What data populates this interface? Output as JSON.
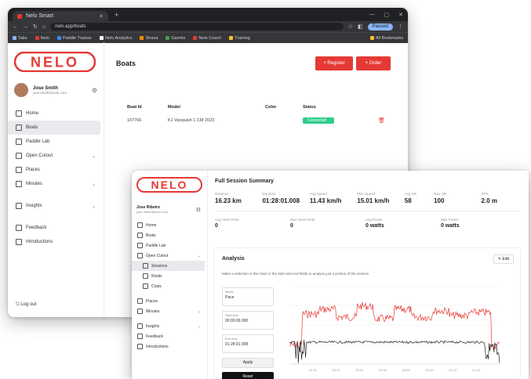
{
  "browser": {
    "tab_title": "Nelo Smart",
    "url": "nelo.app/boats",
    "profile_label": "Paused",
    "bookmarks": [
      "Tabs",
      "Nelo",
      "Paddle Tracker",
      "Nelo Analytics",
      "Strava",
      "Garmin",
      "Nelo Coach",
      "Training",
      "All Bookmarks"
    ]
  },
  "app1": {
    "logo_text": "NELO",
    "user": {
      "name": "Jose Smith",
      "email": "jose.smith@nelo.com"
    },
    "nav": [
      {
        "label": "Home",
        "icon": "home-icon"
      },
      {
        "label": "Boats",
        "icon": "boat-icon"
      },
      {
        "label": "Paddle Lab",
        "icon": "paddle-icon"
      },
      {
        "label": "Open Cutout",
        "icon": "session-icon"
      },
      {
        "label": "Places",
        "icon": "place-icon"
      },
      {
        "label": "Minutes",
        "icon": "clock-icon"
      },
      {
        "label": "Insights",
        "icon": "chart-icon"
      },
      {
        "label": "Feedback",
        "icon": "feedback-icon"
      },
      {
        "label": "Introductions",
        "icon": "users-icon"
      }
    ],
    "logout_label": "Log out",
    "page_title": "Boats",
    "buttons": {
      "register": "+ Register",
      "order": "+ Order"
    },
    "table": {
      "headers": [
        "Boat Id",
        "Model",
        "Color",
        "Status"
      ],
      "rows": [
        {
          "id": "107766",
          "model": "K1 Vanquish 1 CM 2023",
          "color": "",
          "status": "Connected"
        }
      ]
    }
  },
  "app2": {
    "logo_text": "NELO",
    "user": {
      "name": "Jose Ribeiro",
      "email": "jose.ribeiro@nelo.com"
    },
    "nav": [
      {
        "label": "Home",
        "sub": false,
        "chev": false,
        "active": false
      },
      {
        "label": "Boats",
        "sub": false,
        "chev": false,
        "active": false
      },
      {
        "label": "Paddle Lab",
        "sub": false,
        "chev": false,
        "active": false
      },
      {
        "label": "Open Cutout",
        "sub": false,
        "chev": true,
        "active": false
      },
      {
        "label": "Sessions",
        "sub": true,
        "chev": false,
        "active": true
      },
      {
        "label": "Rivals",
        "sub": true,
        "chev": false,
        "active": false
      },
      {
        "label": "Clubs",
        "sub": true,
        "chev": false,
        "active": false
      },
      {
        "label": "Places",
        "sub": false,
        "chev": false,
        "active": false
      },
      {
        "label": "Minutes",
        "sub": false,
        "chev": true,
        "active": false
      },
      {
        "label": "Insights",
        "sub": false,
        "chev": true,
        "active": false
      },
      {
        "label": "Feedback",
        "sub": false,
        "chev": false,
        "active": false
      },
      {
        "label": "Introductions",
        "sub": false,
        "chev": false,
        "active": false
      }
    ],
    "summary_title": "Full Session Summary",
    "stats": [
      {
        "label": "Distance",
        "value": "16.23 km"
      },
      {
        "label": "Duration",
        "value": "01:28:01.008"
      },
      {
        "label": "Avg Speed",
        "value": "11.43 km/h"
      },
      {
        "label": "Max Speed",
        "value": "15.01 km/h"
      },
      {
        "label": "Avg SR",
        "value": "58"
      },
      {
        "label": "Max SR",
        "value": "100"
      },
      {
        "label": "DPS",
        "value": "2.0 m"
      }
    ],
    "stats2": [
      {
        "label": "Avg Heart Rate",
        "value": "0"
      },
      {
        "label": "Max Heart Rate",
        "value": "0"
      },
      {
        "label": "Avg Power",
        "value": "0 watts"
      },
      {
        "label": "Max Power",
        "value": "0 watts"
      }
    ],
    "analysis": {
      "title": "Analysis",
      "export_label": "Edit",
      "description": "Make a selection in the chart or the start and end fields to analyse just a portion of the session",
      "fields": [
        {
          "label": "Metric",
          "value": "Pace"
        },
        {
          "label": "Start time",
          "value": "00:00:00.000"
        },
        {
          "label": "End time",
          "value": "01:28:01.008"
        }
      ],
      "apply_label": "Apply",
      "reset_label": "Reset",
      "x_ticks": [
        "00:10",
        "00:20",
        "00:30",
        "00:40",
        "00:50",
        "01:00",
        "01:10",
        "01:20"
      ]
    }
  }
}
